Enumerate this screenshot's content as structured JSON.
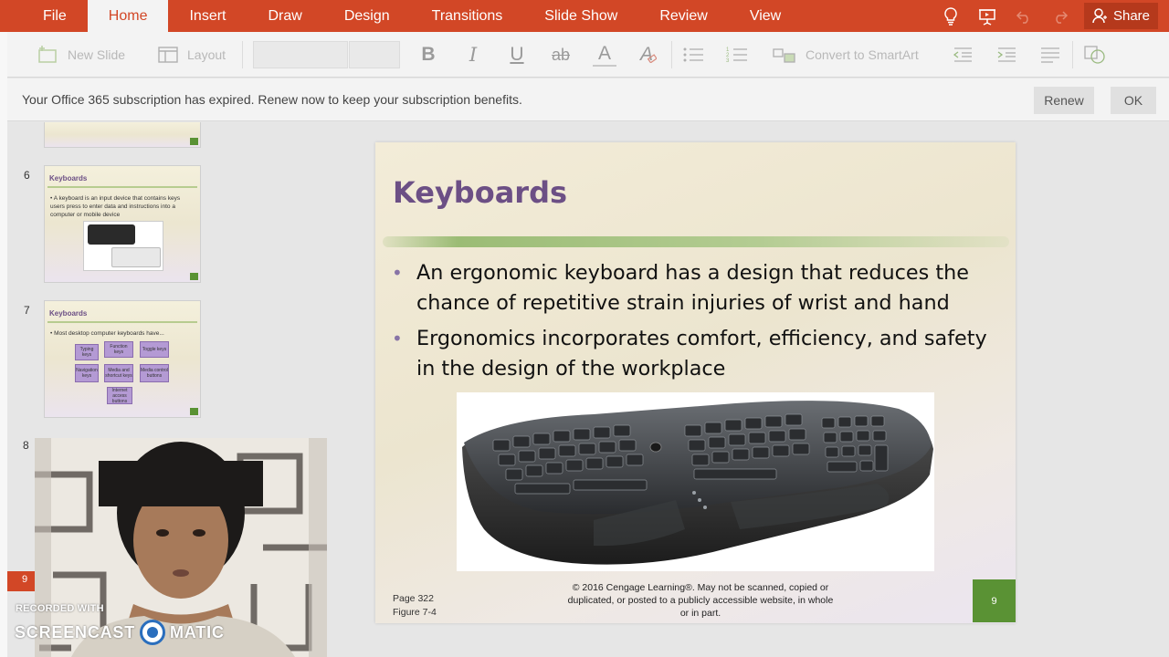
{
  "tabs": [
    {
      "label": "File"
    },
    {
      "label": "Home",
      "active": true
    },
    {
      "label": "Insert"
    },
    {
      "label": "Draw"
    },
    {
      "label": "Design"
    },
    {
      "label": "Transitions"
    },
    {
      "label": "Slide Show"
    },
    {
      "label": "Review"
    },
    {
      "label": "View"
    }
  ],
  "share_label": "Share",
  "ribbon": {
    "new_slide": "New Slide",
    "layout": "Layout",
    "convert_smartart": "Convert to SmartArt",
    "bold": "B",
    "italic": "I",
    "underline": "U",
    "strike": "ab",
    "font_color": "A",
    "clear_format": "A"
  },
  "notice": {
    "text": "Your Office 365 subscription has expired. Renew now to keep your subscription benefits.",
    "renew": "Renew",
    "ok": "OK"
  },
  "thumbs": {
    "slide6": {
      "num": "6",
      "title": "Keyboards",
      "body": "• A keyboard is an input device that contains keys users press to enter data and instructions into a computer or mobile device"
    },
    "slide7": {
      "num": "7",
      "title": "Keyboards",
      "body": "• Most desktop computer keyboards have...",
      "boxes": [
        "Typing keys",
        "Function keys",
        "Toggle keys",
        "Navigation keys",
        "Media and shortcut keys",
        "Media control buttons",
        "Internet access buttons"
      ]
    },
    "slide8_num": "8",
    "slide9_num": "9"
  },
  "slide": {
    "title": "Keyboards",
    "bullets": [
      "An ergonomic keyboard has a design that reduces the chance of repetitive strain injuries of wrist and hand",
      "Ergonomics incorporates comfort, efficiency, and safety in the design of the workplace"
    ],
    "page_ref": "Page 322",
    "figure_ref": "Figure 7-4",
    "copyright": "© 2016 Cengage Learning®. May not be scanned, copied or duplicated, or posted to a publicly accessible website, in whole or in part.",
    "number": "9"
  },
  "screencast": {
    "recorded": "RECORDED WITH",
    "brand_left": "SCREENCAST",
    "brand_right": "MATIC"
  },
  "colors": {
    "accent": "#d24726",
    "title_purple": "#6c4f85",
    "slide_green": "#5a9234"
  }
}
